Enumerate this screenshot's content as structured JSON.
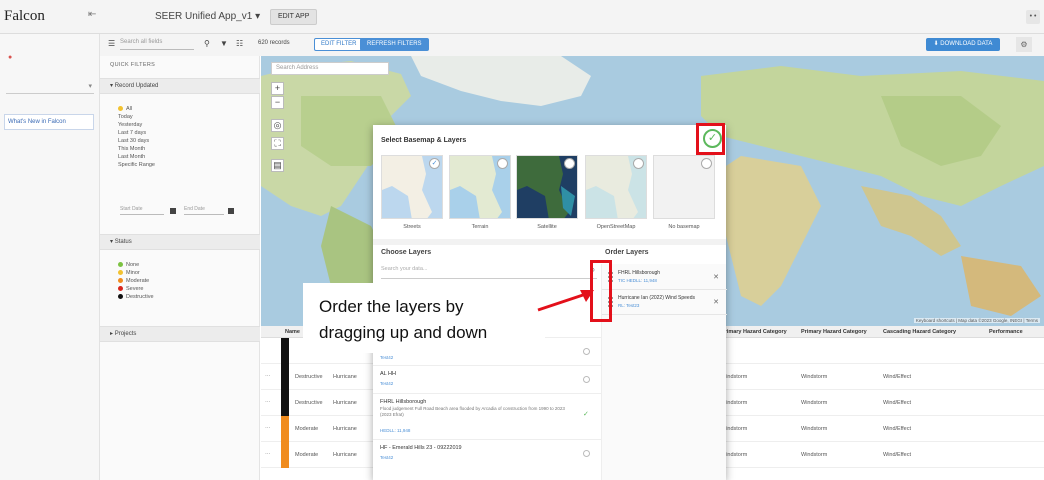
{
  "app": {
    "logo": "Falcon",
    "title": "SEER Unified App_v1",
    "edit_button": "EDIT APP",
    "more": "• •"
  },
  "sidebar": {
    "whats_new": "What's New in Falcon"
  },
  "toolbar": {
    "search_placeholder": "Search all fields",
    "records": "620 records",
    "btn_edit_filter": "EDIT FILTER",
    "btn_reset_filters": "REFRESH FILTERS",
    "download_button": "DOWNLOAD DATA"
  },
  "filters": {
    "quick_filters": "QUICK FILTERS",
    "record_updated": {
      "label": "Record Updated",
      "options": [
        "All",
        "Today",
        "Yesterday",
        "Last 7 days",
        "Last 30 days",
        "This Month",
        "Last Month",
        "Specific Range"
      ],
      "start_placeholder": "Start Date",
      "end_placeholder": "End Date"
    },
    "status": {
      "label": "Status",
      "options": [
        {
          "label": "None",
          "color": "#7cc242"
        },
        {
          "label": "Minor",
          "color": "#f2c230"
        },
        {
          "label": "Moderate",
          "color": "#f08c1e"
        },
        {
          "label": "Severe",
          "color": "#d9261c"
        },
        {
          "label": "Destructive",
          "color": "#111111"
        }
      ]
    },
    "projects": {
      "label": "Projects"
    }
  },
  "map": {
    "search_placeholder": "Search Address",
    "zoom_in": "+",
    "zoom_out": "−",
    "credits": "Keyboard shortcuts  |  Map data ©2023 Google, INEGI  |  Terms"
  },
  "table": {
    "headers": [
      "Name",
      "Primary Hazard Category",
      "Primary Hazard Category",
      "Cascading Hazard Category",
      "Performance"
    ],
    "rows": [
      {
        "status": "Destructive",
        "code": "Hurricane",
        "cat": "Windstorm",
        "casc": "Wind/Effect",
        "color": "#111111"
      },
      {
        "status": "Destructive",
        "code": "Hurricane",
        "cat": "Windstorm",
        "casc": "Wind/Effect",
        "color": "#111111"
      },
      {
        "status": "Moderate",
        "code": "Hurricane",
        "cat": "Windstorm",
        "casc": "Wind/Effect",
        "color": "#f08c1e"
      },
      {
        "status": "Moderate",
        "code": "Hurricane",
        "cat": "Windstorm",
        "casc": "Wind/Effect",
        "color": "#f08c1e"
      }
    ]
  },
  "modal": {
    "title": "Select Basemap & Layers",
    "confirm_icon": "✓",
    "basemaps": [
      {
        "label": "Streets",
        "selected": true
      },
      {
        "label": "Terrain",
        "selected": false
      },
      {
        "label": "Satellite",
        "selected": false
      },
      {
        "label": "OpenStreetMap",
        "selected": false
      },
      {
        "label": "No basemap",
        "selected": false
      }
    ],
    "choose_layers": {
      "heading": "Choose Layers",
      "search_placeholder": "Search your data...",
      "items": [
        {
          "name": "AL HH",
          "meta": "Test42",
          "checked": false
        },
        {
          "name": "FHRL Hillsborough",
          "desc": "Flood judgement Full Road Beach area flooded by Arcadia of construction from 1990 to 2023 (2023 Efrat)",
          "meta": "HEDLL: 11,948",
          "checked": true
        },
        {
          "name": "HF - Emerald Hills 23 - 09222019",
          "meta": "Test42",
          "checked": false
        }
      ],
      "top_meta": "Test42"
    },
    "order_layers": {
      "heading": "Order Layers",
      "items": [
        {
          "name": "FHRL Hillsborough",
          "meta": "TIC HEDLL: 11,948"
        },
        {
          "name": "Hurricane Ian (2022) Wind Speeds",
          "meta": "RL: Test23"
        }
      ]
    }
  },
  "annotation": {
    "line1": "Order the layers by",
    "line2": "dragging up and down"
  },
  "colors": {
    "accent": "#4a8fd6",
    "annotation_red": "#e3101a",
    "confirm_green": "#5cb85c"
  }
}
